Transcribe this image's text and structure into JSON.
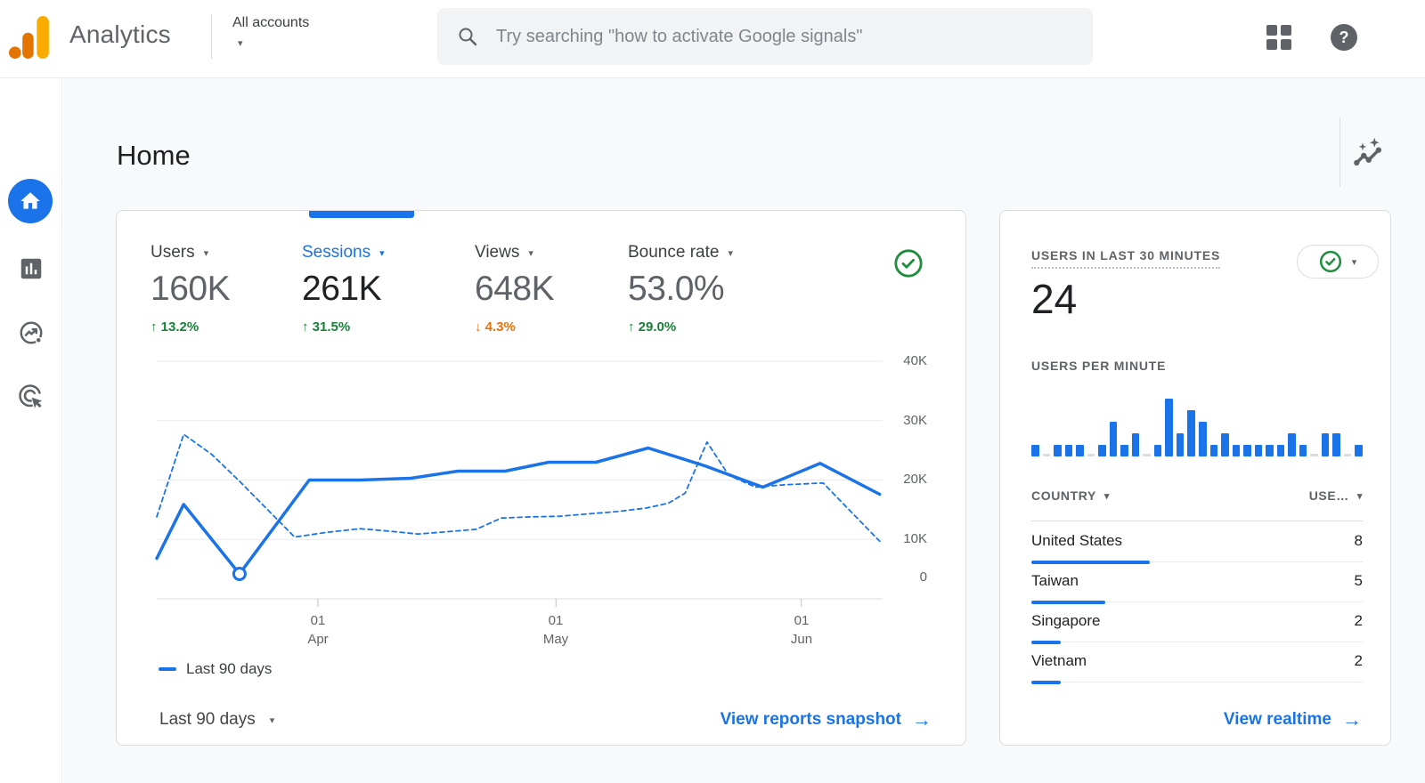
{
  "icons": {
    "dropdown_caret": "▾",
    "help_glyph": "?",
    "link_arrow": "→"
  },
  "header": {
    "product_name": "Analytics",
    "account_selector": "All accounts",
    "search_placeholder": "Try searching \"how to activate Google signals\""
  },
  "sidebar": {
    "items": [
      {
        "name": "home",
        "selected": true
      },
      {
        "name": "reports",
        "selected": false
      },
      {
        "name": "explore",
        "selected": false
      },
      {
        "name": "advertising",
        "selected": false
      }
    ]
  },
  "page": {
    "title": "Home"
  },
  "home_card": {
    "metrics": [
      {
        "label": "Users",
        "value": "160K",
        "arrow": "↑",
        "delta": "13.2%",
        "direction": "up",
        "selected": false
      },
      {
        "label": "Sessions",
        "value": "261K",
        "arrow": "↑",
        "delta": "31.5%",
        "direction": "up",
        "selected": true
      },
      {
        "label": "Views",
        "value": "648K",
        "arrow": "↓",
        "delta": "4.3%",
        "direction": "down",
        "selected": false
      },
      {
        "label": "Bounce rate",
        "value": "53.0%",
        "arrow": "↑",
        "delta": "29.0%",
        "direction": "up",
        "selected": false
      }
    ],
    "date_range": "Last 90 days",
    "link": "View reports snapshot"
  },
  "realtime_card": {
    "title": "USERS IN LAST 30 MINUTES",
    "users_30min": "24",
    "per_minute_label": "USERS PER MINUTE",
    "link": "View realtime"
  },
  "chart_data": [
    {
      "type": "line",
      "title": "Sessions trend, last 90 days vs previous period",
      "legend": [
        "Last 90 days"
      ],
      "y_max": 40000,
      "y_ticks": [
        {
          "label": "40K",
          "value": 40000
        },
        {
          "label": "30K",
          "value": 30000
        },
        {
          "label": "20K",
          "value": 20000
        },
        {
          "label": "10K",
          "value": 10000
        },
        {
          "label": "0",
          "value": 0
        }
      ],
      "x_ticks": [
        {
          "pos": 22.2,
          "line1": "01",
          "line2": "Apr"
        },
        {
          "pos": 55.0,
          "line1": "01",
          "line2": "May"
        },
        {
          "pos": 88.8,
          "line1": "01",
          "line2": "Jun"
        }
      ],
      "grid": true,
      "series": [
        {
          "id": "current",
          "style": "solid",
          "points": [
            [
              0,
              6800
            ],
            [
              3.7,
              15900
            ],
            [
              11.4,
              4200
            ],
            [
              21,
              20000
            ],
            [
              28,
              20000
            ],
            [
              35,
              20300
            ],
            [
              41.5,
              21500
            ],
            [
              48,
              21500
            ],
            [
              54,
              23000
            ],
            [
              60.5,
              23000
            ],
            [
              67.7,
              25400
            ],
            [
              75.5,
              22400
            ],
            [
              83.5,
              18800
            ],
            [
              91.4,
              22800
            ],
            [
              99.6,
              17600
            ]
          ]
        },
        {
          "id": "previous",
          "style": "dashed",
          "points": [
            [
              0,
              13800
            ],
            [
              3.7,
              27700
            ],
            [
              7.6,
              24300
            ],
            [
              11.4,
              19800
            ],
            [
              19,
              10400
            ],
            [
              23.5,
              11200
            ],
            [
              28,
              11800
            ],
            [
              32,
              11400
            ],
            [
              36,
              10900
            ],
            [
              40,
              11300
            ],
            [
              44,
              11700
            ],
            [
              47.5,
              13600
            ],
            [
              51.5,
              13800
            ],
            [
              55.5,
              13900
            ],
            [
              59.5,
              14300
            ],
            [
              63.5,
              14700
            ],
            [
              67.5,
              15300
            ],
            [
              70.5,
              16100
            ],
            [
              72.8,
              17800
            ],
            [
              75.8,
              26400
            ],
            [
              78.8,
              20800
            ],
            [
              82.5,
              18800
            ],
            [
              86.5,
              19200
            ],
            [
              90,
              19400
            ],
            [
              91.8,
              19500
            ],
            [
              99.6,
              9700
            ]
          ]
        }
      ],
      "marker": {
        "series": 0,
        "index": 2
      }
    },
    {
      "type": "bar",
      "title": "Users per minute (last 30 minutes)",
      "values": [
        1,
        0,
        1,
        1,
        1,
        0,
        1,
        3,
        1,
        2,
        0,
        1,
        5,
        2,
        4,
        3,
        1,
        2,
        1,
        1,
        1,
        1,
        1,
        2,
        1,
        0,
        2,
        2,
        0,
        1
      ],
      "y_max": 5
    },
    {
      "type": "table",
      "columns": [
        "COUNTRY",
        "USE…"
      ],
      "rows": [
        {
          "name": "United States",
          "users": 8
        },
        {
          "name": "Taiwan",
          "users": 5
        },
        {
          "name": "Singapore",
          "users": 2
        },
        {
          "name": "Vietnam",
          "users": 2
        }
      ],
      "bar_max": 8
    }
  ]
}
